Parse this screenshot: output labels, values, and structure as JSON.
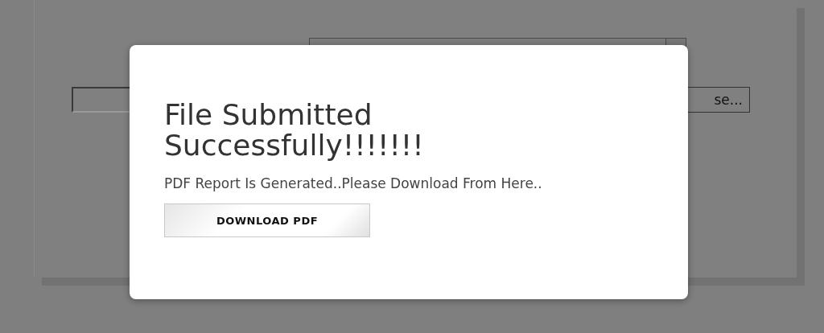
{
  "form": {
    "browse_button": "se..."
  },
  "dialog": {
    "title": "File Submitted Successfully!!!!!!!",
    "message": "PDF Report Is Generated..Please Download From Here..",
    "button": "DOWNLOAD PDF"
  }
}
